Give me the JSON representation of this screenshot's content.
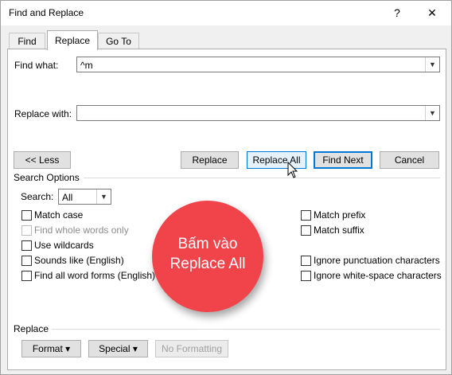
{
  "window": {
    "title": "Find and Replace",
    "help_label": "?",
    "close_label": "✕"
  },
  "tabs": [
    {
      "label": "Find",
      "active": false
    },
    {
      "label": "Replace",
      "active": true
    },
    {
      "label": "Go To",
      "active": false
    }
  ],
  "find": {
    "label": "Find what:",
    "value": "^m"
  },
  "replace": {
    "label": "Replace with:",
    "value": ""
  },
  "buttons": {
    "less": "<< Less",
    "replace": "Replace",
    "replace_all": "Replace All",
    "find_next": "Find Next",
    "cancel": "Cancel"
  },
  "search_options": {
    "heading": "Search Options",
    "search_label": "Search:",
    "search_value": "All",
    "left_options": [
      {
        "label": "Match case",
        "checked": false,
        "disabled": false
      },
      {
        "label": "Find whole words only",
        "checked": false,
        "disabled": true
      },
      {
        "label": "Use wildcards",
        "checked": false,
        "disabled": false
      },
      {
        "label": "Sounds like (English)",
        "checked": false,
        "disabled": false
      },
      {
        "label": "Find all word forms (English)",
        "checked": false,
        "disabled": false
      }
    ],
    "right_options": [
      {
        "label": "Match prefix",
        "checked": false
      },
      {
        "label": "Match suffix",
        "checked": false
      },
      {
        "label": "Ignore punctuation characters",
        "checked": false
      },
      {
        "label": "Ignore white-space characters",
        "checked": false
      }
    ]
  },
  "replace_section": {
    "heading": "Replace",
    "format": "Format ▾",
    "special": "Special ▾",
    "no_formatting": "No Formatting"
  },
  "callout": {
    "line1": "Bấm vào",
    "line2": "Replace All",
    "color": "#f0434a"
  },
  "accent_color": "#0078d7"
}
